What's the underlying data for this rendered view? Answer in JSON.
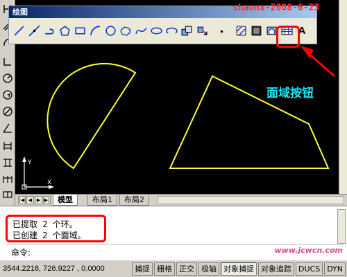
{
  "toolbar": {
    "title": "绘图",
    "text_button_glyph": "A",
    "icons": [
      "line-icon",
      "construction-line-icon",
      "polyline-icon",
      "polygon-icon",
      "rectangle-icon",
      "arc-icon",
      "circle-icon",
      "revision-cloud-icon",
      "spline-icon",
      "ellipse-icon",
      "ellipse-arc-icon",
      "insert-block-icon",
      "make-block-icon",
      "point-icon",
      "hatch-icon",
      "gradient-icon",
      "region-icon",
      "table-icon",
      "multiline-text-icon"
    ]
  },
  "watermark": "shaonx-2008-6-23",
  "annotation": {
    "label": "面域按钮",
    "color": "#18e6f2",
    "highlight_color": "#ff0000"
  },
  "tabs": {
    "items": [
      "模型",
      "布局1",
      "布局2"
    ],
    "active": "模型"
  },
  "command": {
    "lines": [
      "已提取 2 个环。",
      "已创建 2 个面域。"
    ],
    "prompt": "命令:"
  },
  "status": {
    "coordinates": "3544.2216, 726.9227 , 0.0000",
    "buttons": [
      "捕捉",
      "栅格",
      "正交",
      "极轴",
      "对象捕捉",
      "对象追踪",
      "DUCS",
      "DYN"
    ]
  },
  "site_mark": "www.jcwcn.com",
  "drawing": {
    "line_color": "#ffff33"
  }
}
